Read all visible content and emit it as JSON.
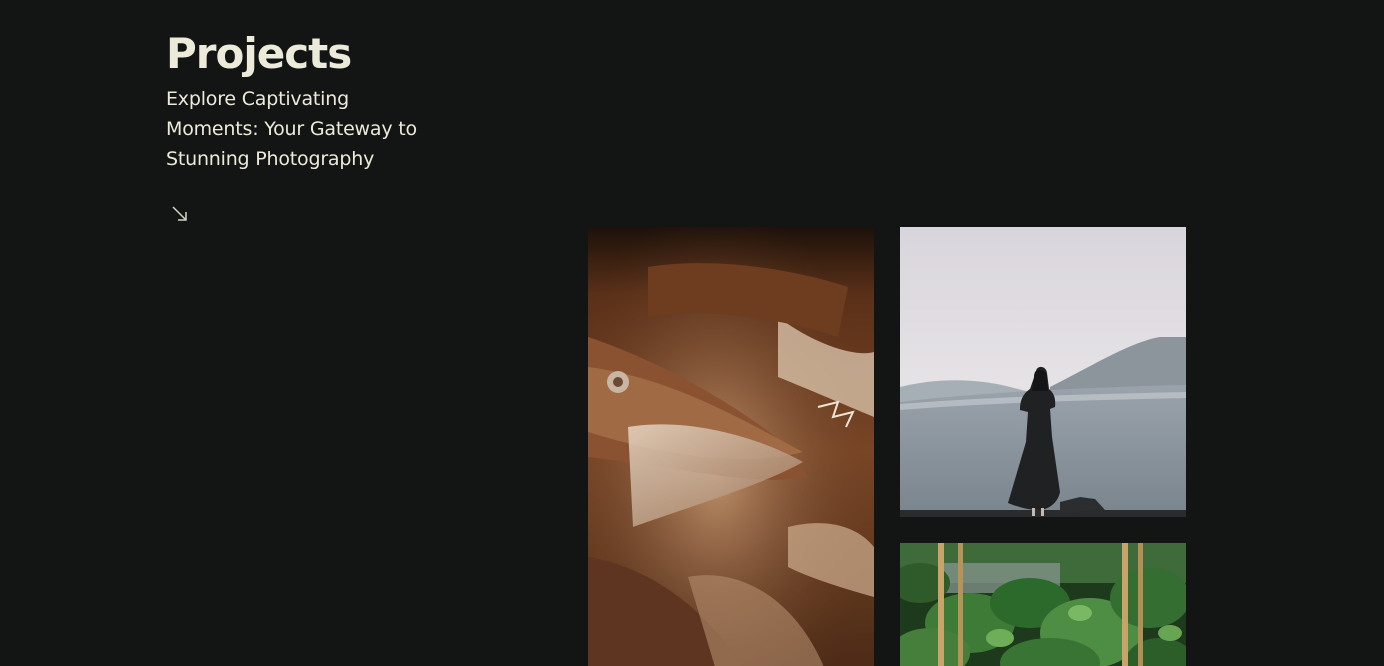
{
  "header": {
    "title": "Projects",
    "subtitle": "Explore Captivating Moments: Your Gateway to Stunning Photography"
  },
  "icons": {
    "scroll_arrow": "arrow-down-right-icon"
  },
  "gallery": {
    "photos": [
      {
        "subject": "dried fish"
      },
      {
        "subject": "woman in black dress overlooking misty mountains"
      },
      {
        "subject": "green climbing plants on bamboo poles"
      }
    ]
  },
  "colors": {
    "background": "#131414",
    "text": "#ecead9"
  }
}
